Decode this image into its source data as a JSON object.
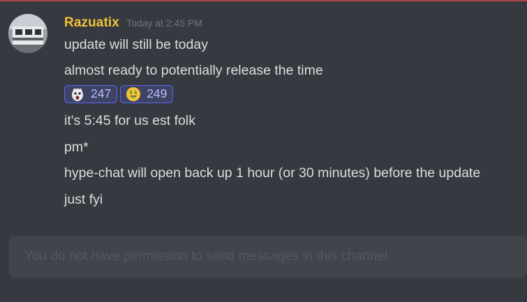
{
  "message": {
    "author": "Razuatix",
    "timestamp": "Today at 2:45 PM",
    "lines": [
      "update will still be today",
      "almost ready to potentially release the time",
      "it's 5:45 for us est folk",
      "pm*",
      "hype-chat will open back up 1 hour (or 30 minutes) before the update",
      "just fyi"
    ],
    "reactions": [
      {
        "emoji": "pog-emoji-icon",
        "count": "247"
      },
      {
        "emoji": "money-mouth-face-icon",
        "count": "249"
      }
    ]
  },
  "input": {
    "placeholder": "You do not have permission to send messages in this channel."
  },
  "colors": {
    "background": "#36393f",
    "username": "#f0c236",
    "reaction_bg": "#3e4364",
    "reaction_border": "#5865f2",
    "new_messages_divider": "#b3414a"
  }
}
